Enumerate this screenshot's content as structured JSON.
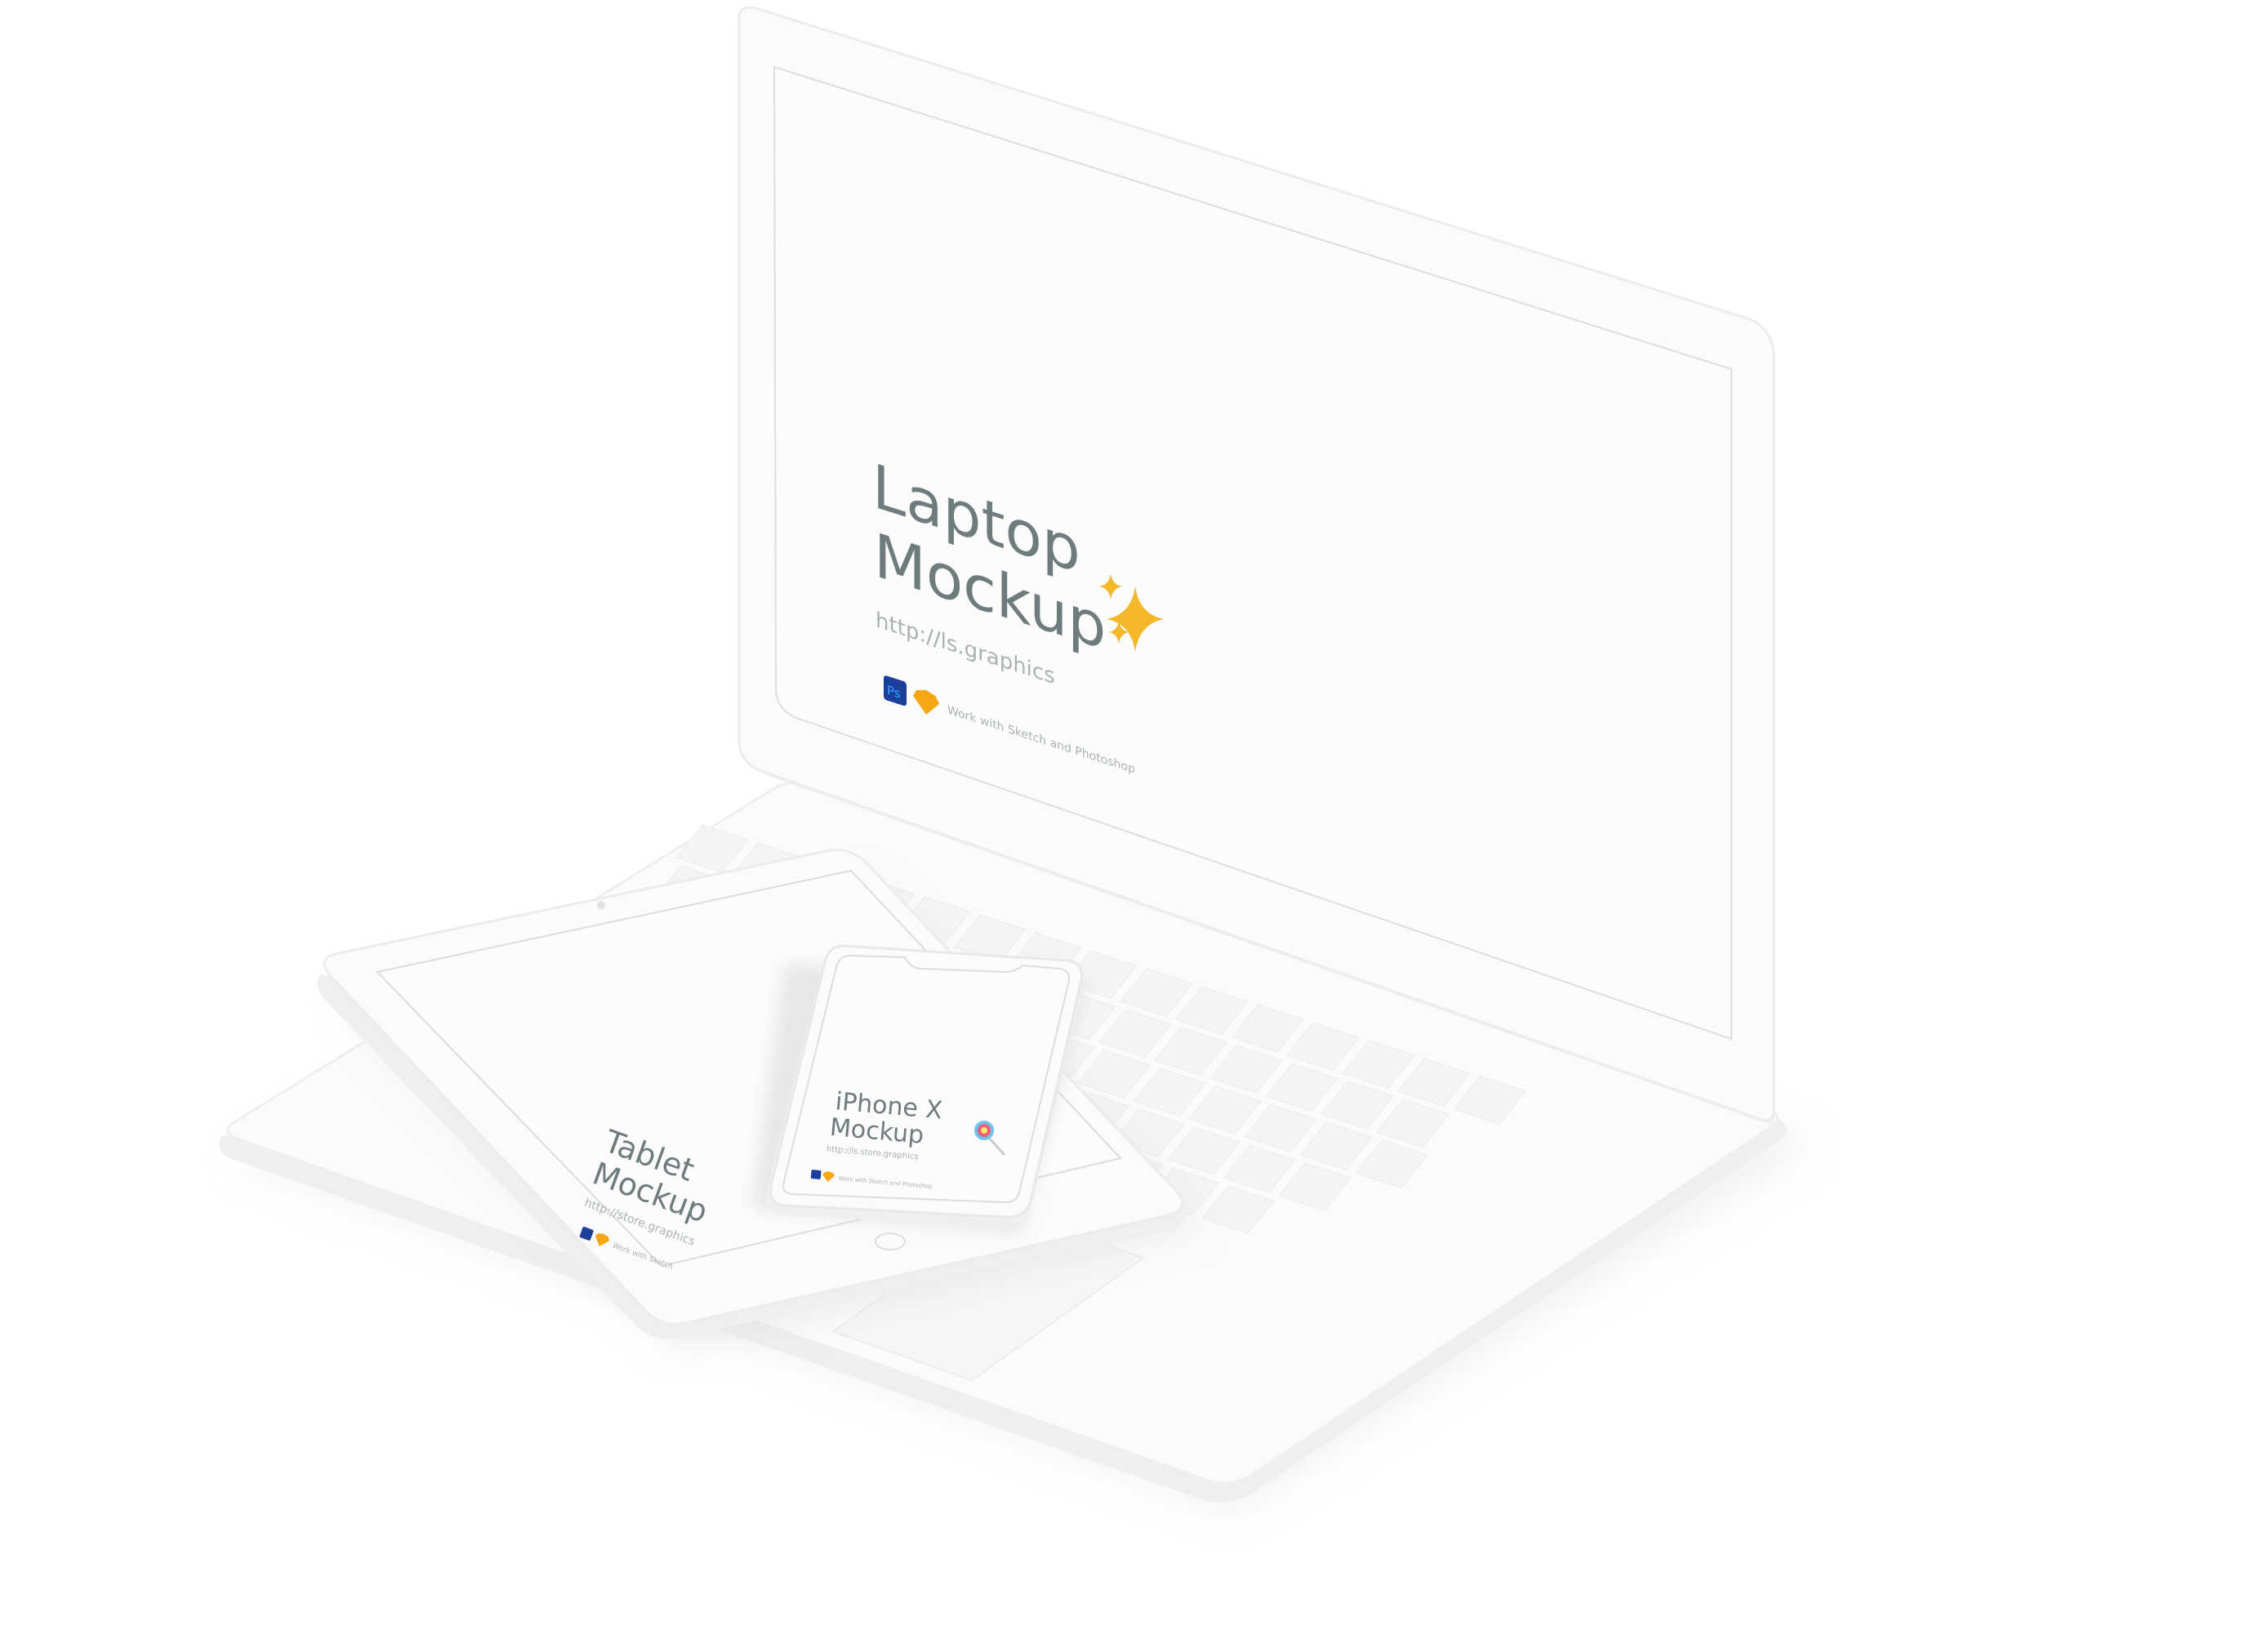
{
  "laptop": {
    "title_line1": "Laptop",
    "title_line2": "Mockup",
    "emoji": "✨",
    "url": "http://ls.graphics",
    "tools_caption": "Work with Sketch and Photoshop",
    "ps_icon_label": "Ps"
  },
  "tablet": {
    "title_line1": "Tablet",
    "title_line2": "Mockup",
    "url": "http://store.graphics",
    "tools_caption": "Work with Sketch",
    "ps_icon_label": "Ps"
  },
  "phone": {
    "title_line1": "iPhone X",
    "title_line2": "Mockup",
    "emoji": "🍭",
    "url": "http://ls.store.graphics",
    "tools_caption": "Work with Sketch and Photoshop",
    "ps_icon_label": "Ps"
  },
  "colors": {
    "background": "#ffffff",
    "device_body": "#fbfbfb",
    "device_edge": "#eeeeee",
    "screen_bezel": "#dcdcdc",
    "keys": "#f4f4f4",
    "title_text": "#6f7c7d",
    "url_text": "#a9b1b2",
    "photoshop_blue": "#1d3f9c",
    "sketch_orange": "#f7a713",
    "sparkle_gold": "#f5b82a"
  }
}
